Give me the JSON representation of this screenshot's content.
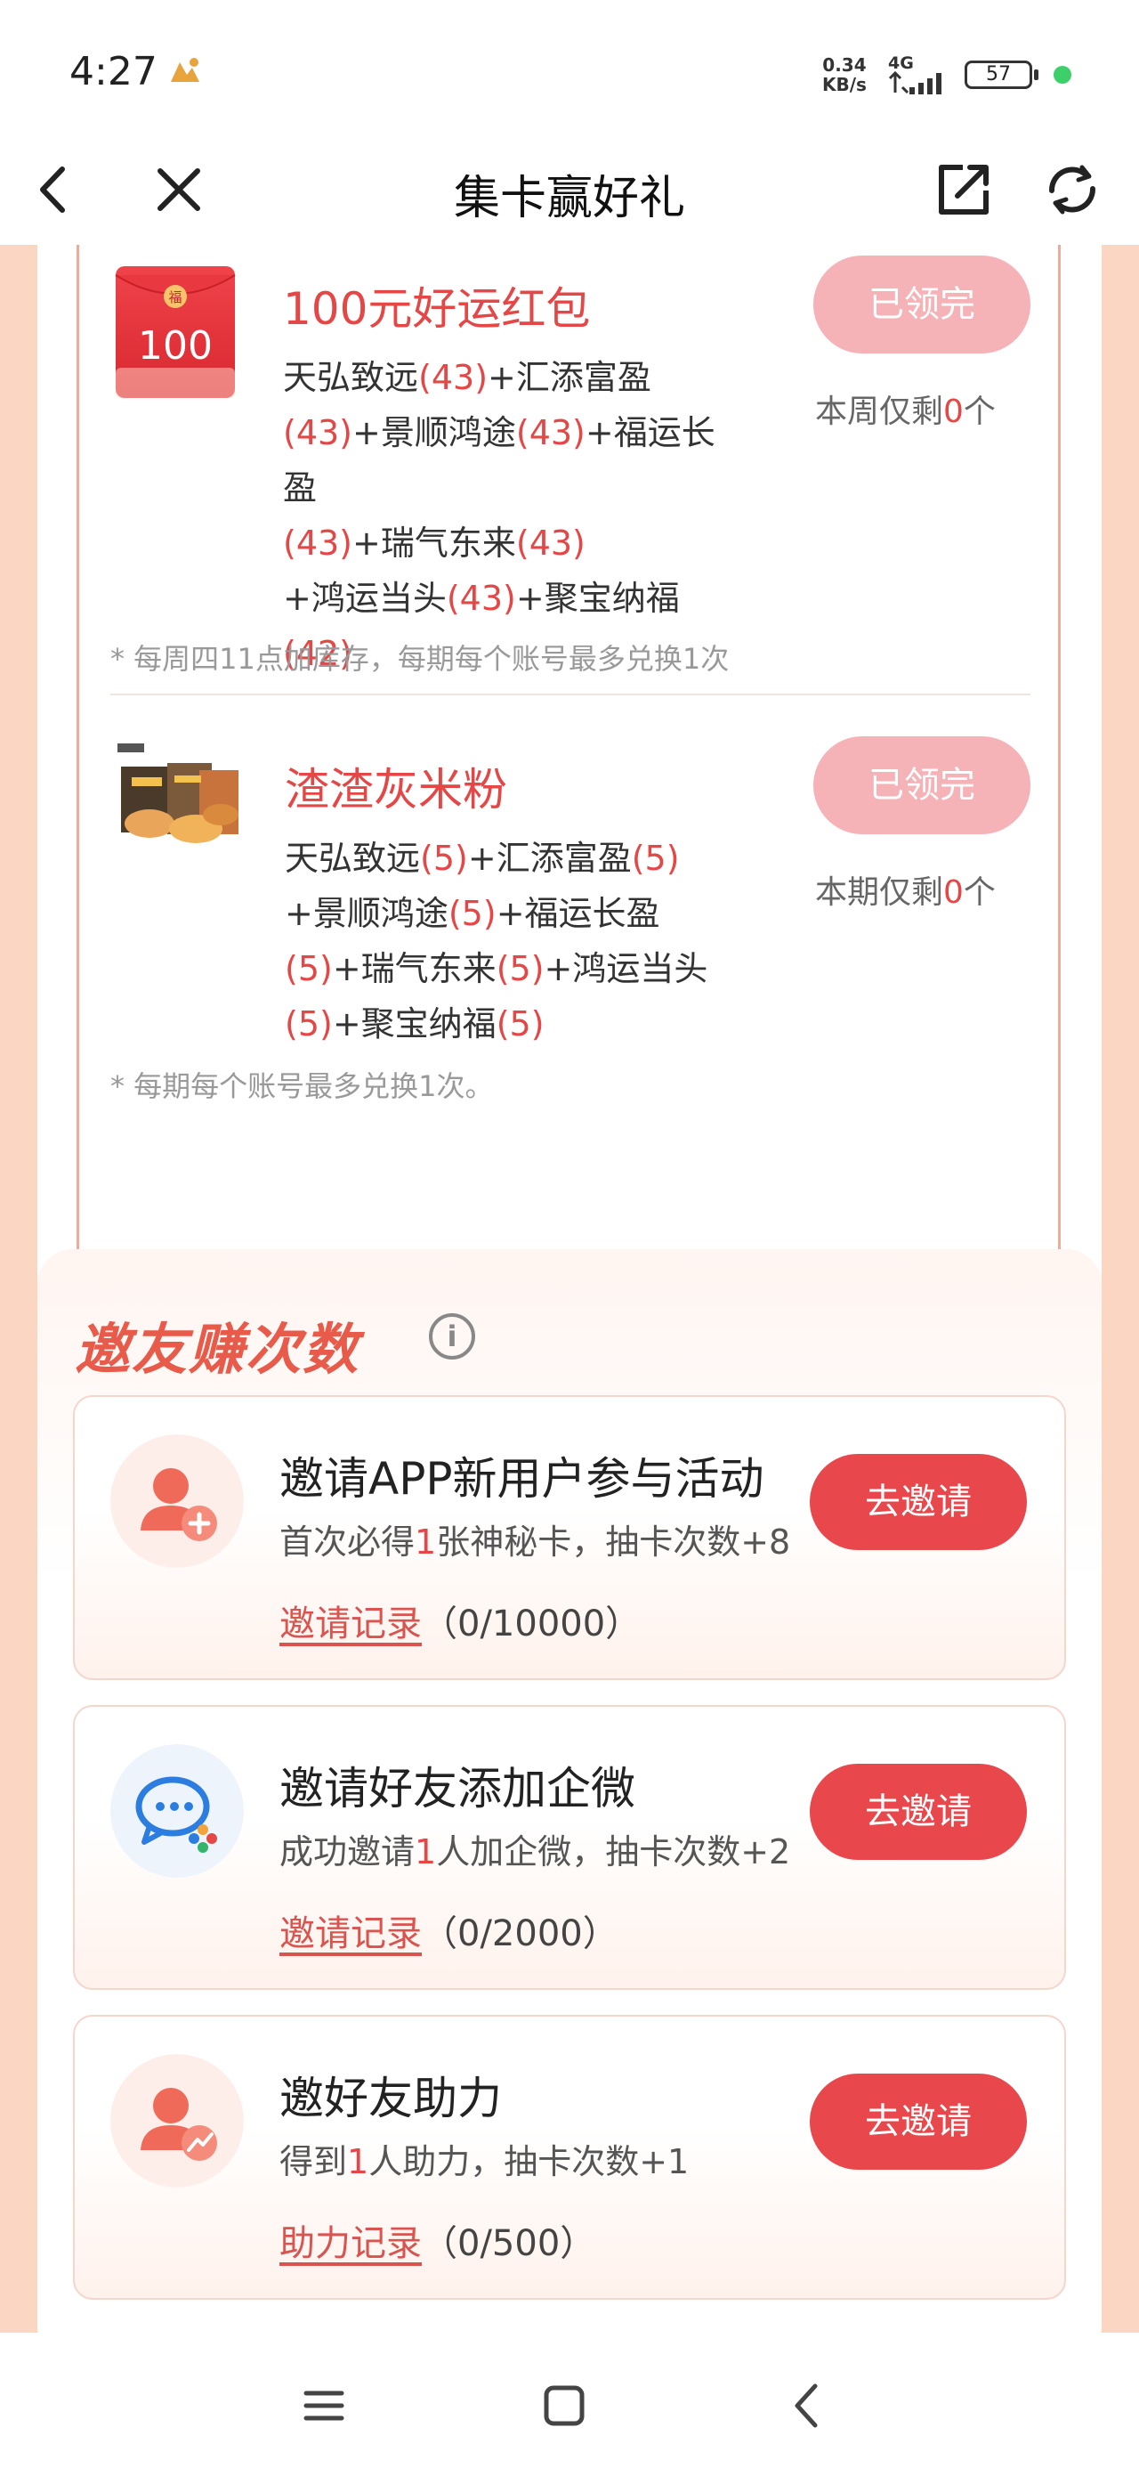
{
  "status_bar": {
    "time": "4:27",
    "net_speed_value": "0.34",
    "net_speed_unit": "KB/s",
    "network": "4G",
    "battery": "57"
  },
  "nav": {
    "title": "集卡赢好礼"
  },
  "rewards": [
    {
      "title": "100元好运红包",
      "badge_value": "100",
      "badge_char": "福",
      "recipe": [
        {
          "name": "天弘致远",
          "count": "(43)"
        },
        {
          "name": "汇添富盈",
          "count": "(43)"
        },
        {
          "name": "景顺鸿途",
          "count": "(43)"
        },
        {
          "name": "福运长盈",
          "count": "(43)"
        },
        {
          "name": "瑞气东来",
          "count": "(43)"
        },
        {
          "name": "鸿运当头",
          "count": "(43)"
        },
        {
          "name": "聚宝纳福",
          "count": "(42)"
        }
      ],
      "button": "已领完",
      "remain_prefix": "本周仅剩",
      "remain_num": "0",
      "remain_suffix": "个",
      "note": "* 每周四11点加库存，每期每个账号最多兑换1次"
    },
    {
      "title": "渣渣灰米粉",
      "recipe": [
        {
          "name": "天弘致远",
          "count": "(5)"
        },
        {
          "name": "汇添富盈",
          "count": "(5)"
        },
        {
          "name": "景顺鸿途",
          "count": "(5)"
        },
        {
          "name": "福运长盈",
          "count": "(5)"
        },
        {
          "name": "瑞气东来",
          "count": "(5)"
        },
        {
          "name": "鸿运当头",
          "count": "(5)"
        },
        {
          "name": "聚宝纳福",
          "count": "(5)"
        }
      ],
      "button": "已领完",
      "remain_prefix": "本期仅剩",
      "remain_num": "0",
      "remain_suffix": "个",
      "note": "* 每期每个账号最多兑换1次。"
    }
  ],
  "invite": {
    "section_title": "邀友赚次数",
    "info_icon": "i",
    "tasks": [
      {
        "title": "邀请APP新用户参与活动",
        "desc_pre": "首次必得",
        "desc_num": "1",
        "desc_post": "张神秘卡，抽卡次数+8",
        "record_label": "邀请记录",
        "record_count": "（0/10000）",
        "button": "去邀请",
        "icon": "add-user-icon"
      },
      {
        "title": "邀请好友添加企微",
        "desc_pre": "成功邀请",
        "desc_num": "1",
        "desc_post": "人加企微，抽卡次数+2",
        "record_label": "邀请记录",
        "record_count": "（0/2000）",
        "button": "去邀请",
        "icon": "wecom-chat-icon"
      },
      {
        "title": "邀好友助力",
        "desc_pre": "得到",
        "desc_num": "1",
        "desc_post": "人助力，抽卡次数+1",
        "record_label": "助力记录",
        "record_count": "（0/500）",
        "button": "去邀请",
        "icon": "boost-user-icon"
      }
    ]
  },
  "colors": {
    "accent_red": "#e54646",
    "button_red": "#e8474b",
    "disabled_pink": "#f5b3b8",
    "page_peach": "#fbd6c2"
  }
}
